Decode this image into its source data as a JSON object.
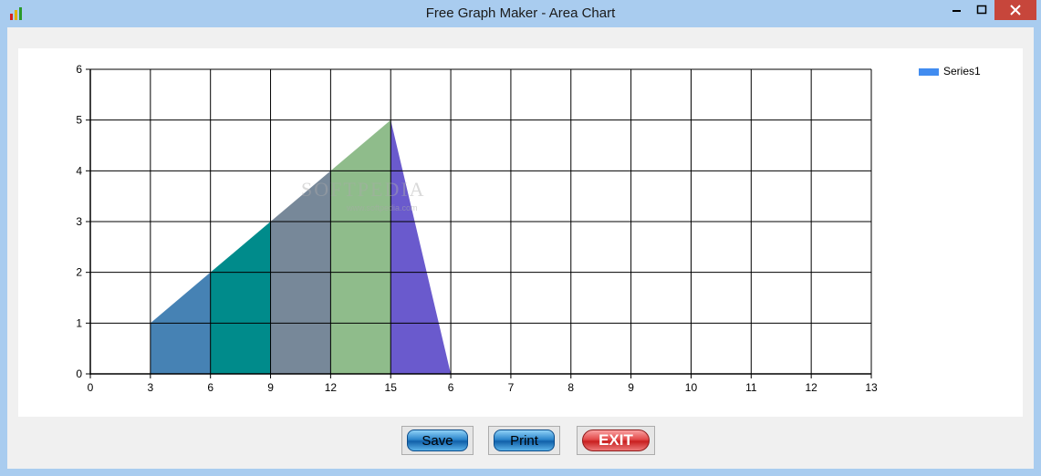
{
  "window": {
    "title": "Free Graph Maker - Area Chart",
    "icon": "bar-chart-app-icon",
    "controls": [
      "minimize-icon",
      "maximize-icon",
      "close-icon"
    ]
  },
  "chart_data": {
    "type": "area",
    "categories": [
      "0",
      "3",
      "6",
      "9",
      "12",
      "15",
      "6",
      "7",
      "8",
      "9",
      "10",
      "11",
      "12",
      "13"
    ],
    "series": [
      {
        "name": "Series1",
        "values": [
          null,
          1,
          2,
          3,
          4,
          5,
          0
        ],
        "segment_colors": [
          "#4682b4",
          "#008b8b",
          "#778899",
          "#8fbc8b",
          "#6a5acd"
        ]
      }
    ],
    "ylim": [
      0,
      6
    ],
    "yticks": [
      "0",
      "1",
      "2",
      "3",
      "4",
      "5",
      "6"
    ],
    "grid": true,
    "legend_position": "top-right"
  },
  "legend": {
    "series_label": "Series1",
    "color": "#418cf0"
  },
  "watermark": {
    "text": "SOFTPEDIA",
    "subtext": "www.softpedia.com"
  },
  "buttons": {
    "save_label": "Save",
    "print_label": "Print",
    "exit_label": "EXIT"
  }
}
